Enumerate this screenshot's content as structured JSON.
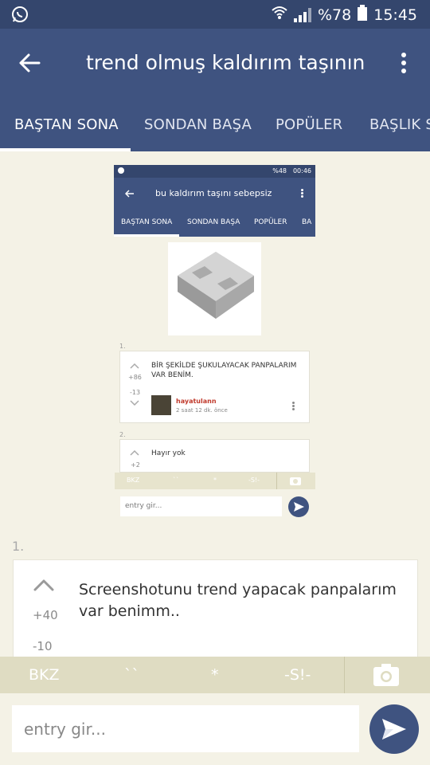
{
  "status_bar": {
    "app_icon": "whatsapp-icon",
    "battery_percent": "%78",
    "time": "15:45"
  },
  "app_bar": {
    "title": "trend olmuş kaldırım taşının",
    "tabs": [
      {
        "label": "BAŞTAN SONA",
        "active": true
      },
      {
        "label": "SONDAN BAŞA",
        "active": false
      },
      {
        "label": "POPÜLER",
        "active": false
      },
      {
        "label": "BAŞLIK S",
        "active": false
      }
    ]
  },
  "embedded_screenshot": {
    "status_battery": "%48",
    "status_time": "00:46",
    "title": "bu kaldırım taşını sebepsiz",
    "tabs": [
      "BAŞTAN SONA",
      "SONDAN BAŞA",
      "POPÜLER",
      "BA"
    ],
    "entries": [
      {
        "number": "1.",
        "text": "BİR ŞEKİLDE ŞUKULAYACAK PANPALARIM VAR BENİM.",
        "upvotes": "+86",
        "downvotes": "-13",
        "author": "hayatulann",
        "time_ago": "2 saat 12 dk. önce"
      },
      {
        "number": "2.",
        "text": "Hayır yok",
        "upvotes": "+2"
      }
    ],
    "toolbar": [
      "BKZ",
      "``",
      "*",
      "-S!-"
    ],
    "input_placeholder": "entry gir..."
  },
  "entry": {
    "number": "1.",
    "text": "Screenshotunu trend yapacak panpalarım var benimm..",
    "upvotes": "+40",
    "downvotes": "-10"
  },
  "toolbar": {
    "bkz": "BKZ",
    "backticks": "``",
    "star": "*",
    "spoiler": "-S!-"
  },
  "input": {
    "placeholder": "entry gir..."
  },
  "colors": {
    "primary": "#3f5380",
    "status_bar": "#34466d",
    "background": "#f4f2e6",
    "toolbar": "#dfdcc2"
  }
}
